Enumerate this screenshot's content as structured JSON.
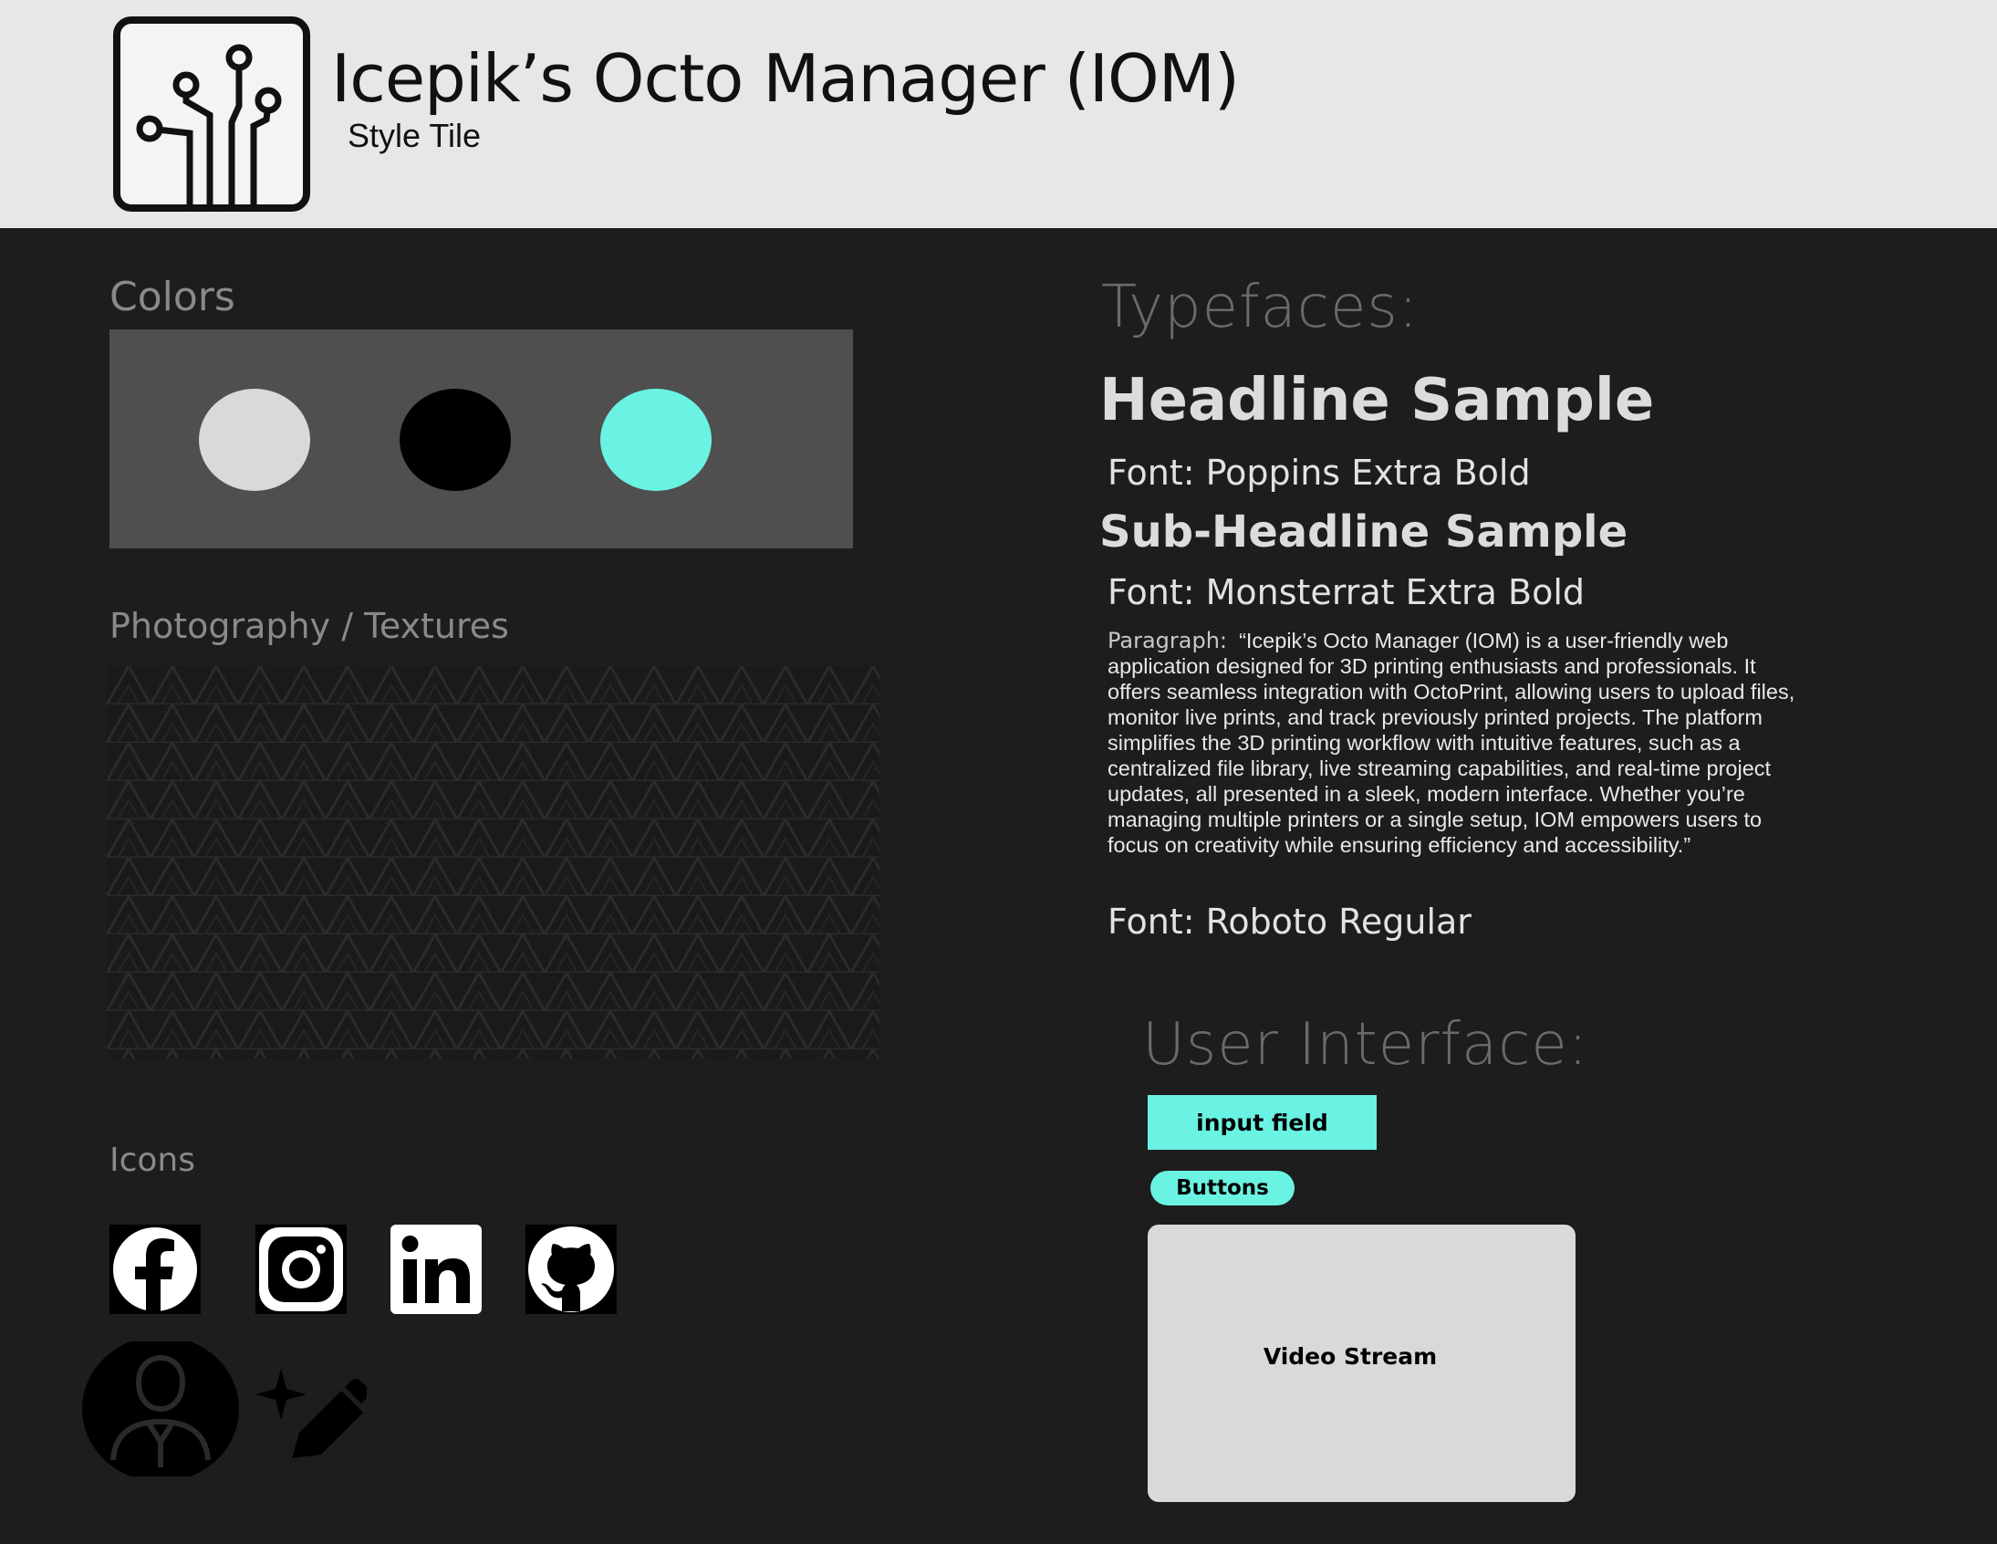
{
  "header": {
    "title": "Icepik’s Octo Manager (IOM)",
    "subtitle": "Style Tile",
    "logo_icon": "circuit-icon"
  },
  "colors": {
    "label": "Colors",
    "swatches": [
      {
        "name": "light-gray",
        "hex": "#d9d9d9"
      },
      {
        "name": "black",
        "hex": "#000000"
      },
      {
        "name": "turquoise",
        "hex": "#6af2e3"
      }
    ]
  },
  "photography": {
    "label": "Photography / Textures"
  },
  "icons": {
    "label": "Icons",
    "items": [
      "facebook-icon",
      "instagram-icon",
      "linkedin-icon",
      "github-icon",
      "user-avatar-icon",
      "ai-edit-icon"
    ]
  },
  "typefaces": {
    "heading": "Typefaces:",
    "headline_sample": "Headline Sample",
    "headline_font": "Font: Poppins Extra Bold",
    "subheadline_sample": "Sub-Headline Sample",
    "subheadline_font": "Font: Monsterrat Extra Bold",
    "paragraph_label": "Paragraph:",
    "paragraph_text": "“Icepik’s Octo Manager (IOM) is a user-friendly web application designed for 3D printing enthusiasts and professionals. It offers seamless integration with OctoPrint, allowing users to upload files, monitor live prints, and track previously printed projects. The platform simplifies the 3D printing workflow with intuitive features, such as a centralized file library, live streaming capabilities, and real-time project updates, all presented in a sleek, modern interface. Whether you’re managing multiple printers or a single setup, IOM empowers users to focus on creativity while ensuring efficiency and accessibility.”",
    "paragraph_font": "Font: Roboto Regular"
  },
  "ui": {
    "heading": "User Interface:",
    "input_label": "input field",
    "button_label": "Buttons",
    "video_label": "Video Stream"
  },
  "accent": "#6af2e3"
}
